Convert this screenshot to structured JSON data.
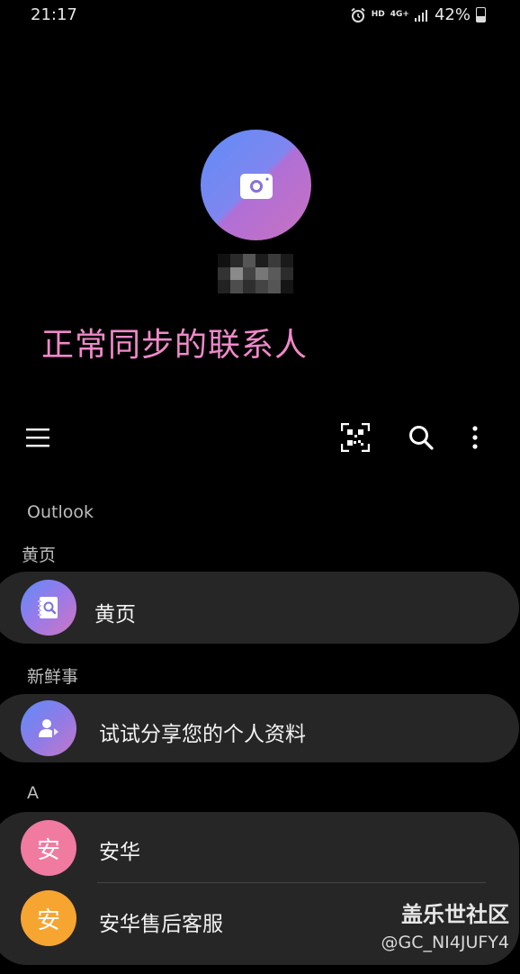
{
  "status": {
    "time": "21:17",
    "hd": "HD",
    "network": "4G+",
    "battery": "42%"
  },
  "profile": {
    "caption": "正常同步的联系人"
  },
  "sections": {
    "outlook": "Outlook",
    "yellow_pages": "黄页",
    "news": "新鲜事",
    "a": "A"
  },
  "items": {
    "yellow_pages": "黄页",
    "share_profile": "试试分享您的个人资料",
    "contact1": {
      "initial": "安",
      "name": "安华"
    },
    "contact2": {
      "initial": "安",
      "name": "安华售后客服"
    }
  },
  "colors": {
    "caption": "#f089c9",
    "contact1_avatar": "#f07aa0",
    "contact2_avatar": "#f7a531"
  },
  "watermark": {
    "line1": "盖乐世社区",
    "line2": "@GC_NI4JUFY4"
  }
}
